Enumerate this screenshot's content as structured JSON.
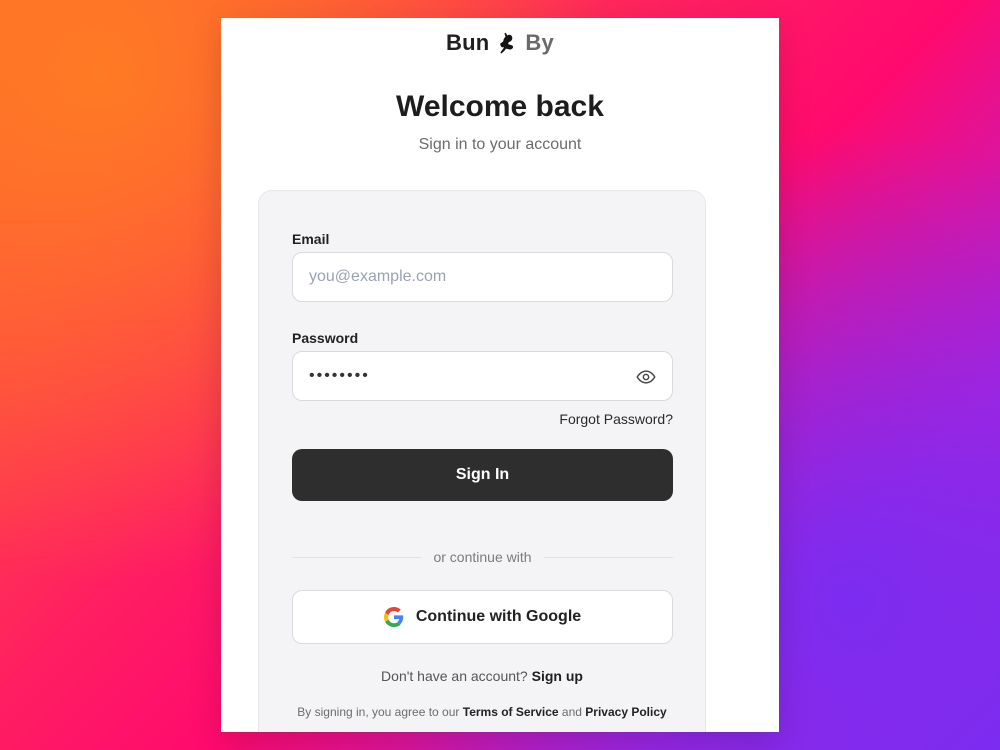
{
  "brand": {
    "left": "Bun",
    "right": "By",
    "logo_icon": "bunny-icon"
  },
  "header": {
    "title": "Welcome back",
    "subtitle": "Sign in to your account"
  },
  "form": {
    "email_label": "Email",
    "email_placeholder": "you@example.com",
    "email_value": "",
    "password_label": "Password",
    "password_value": "••••••••",
    "password_toggle_icon": "eye-icon",
    "forgot_label": "Forgot Password?",
    "signin_label": "Sign In"
  },
  "alt": {
    "divider_text": "or continue with",
    "google_label": "Continue with Google",
    "google_icon": "google-icon"
  },
  "footer": {
    "no_account_text": "Don't have an account?",
    "signup_link": "Sign up",
    "legal_prefix": "By signing in, you agree to our",
    "terms_link": "Terms of Service",
    "and_text": "and",
    "privacy_link": "Privacy Policy"
  },
  "colors": {
    "primary_button": "#2e2e2e",
    "panel_bg": "#f4f4f6",
    "page_gradient": [
      "#ff6a2b",
      "#ff1e62",
      "#b220d8",
      "#7b2cf0"
    ]
  }
}
